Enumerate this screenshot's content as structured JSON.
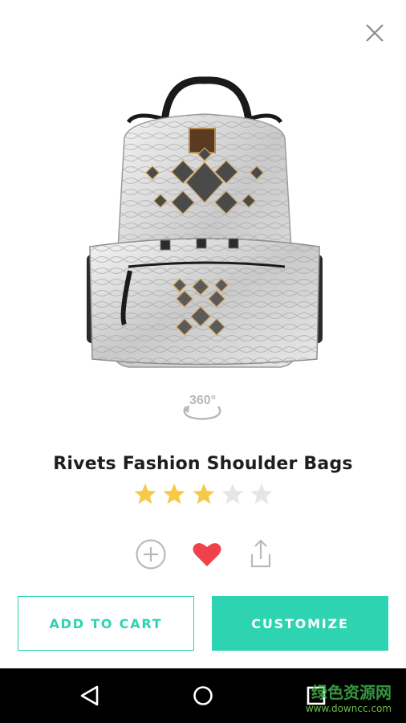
{
  "product": {
    "title": "Rivets Fashion Shoulder Bags",
    "rating": 3,
    "max_rating": 5,
    "rotate_label": "360°"
  },
  "buttons": {
    "add_to_cart": "ADD TO CART",
    "customize": "CUSTOMIZE"
  },
  "icons": {
    "close": "close-icon",
    "add": "plus-circle-icon",
    "favorite": "heart-icon",
    "share": "share-icon",
    "back": "back-triangle-icon",
    "home": "home-circle-icon",
    "recents": "recents-square-icon"
  },
  "colors": {
    "accent": "#2ed3b1",
    "star_on": "#f7c948",
    "star_off": "#e6e6e6",
    "heart": "#f0424a",
    "navbar": "#000000"
  },
  "watermark": {
    "line1": "绿色资源网",
    "line2": "www.downcc.com"
  }
}
